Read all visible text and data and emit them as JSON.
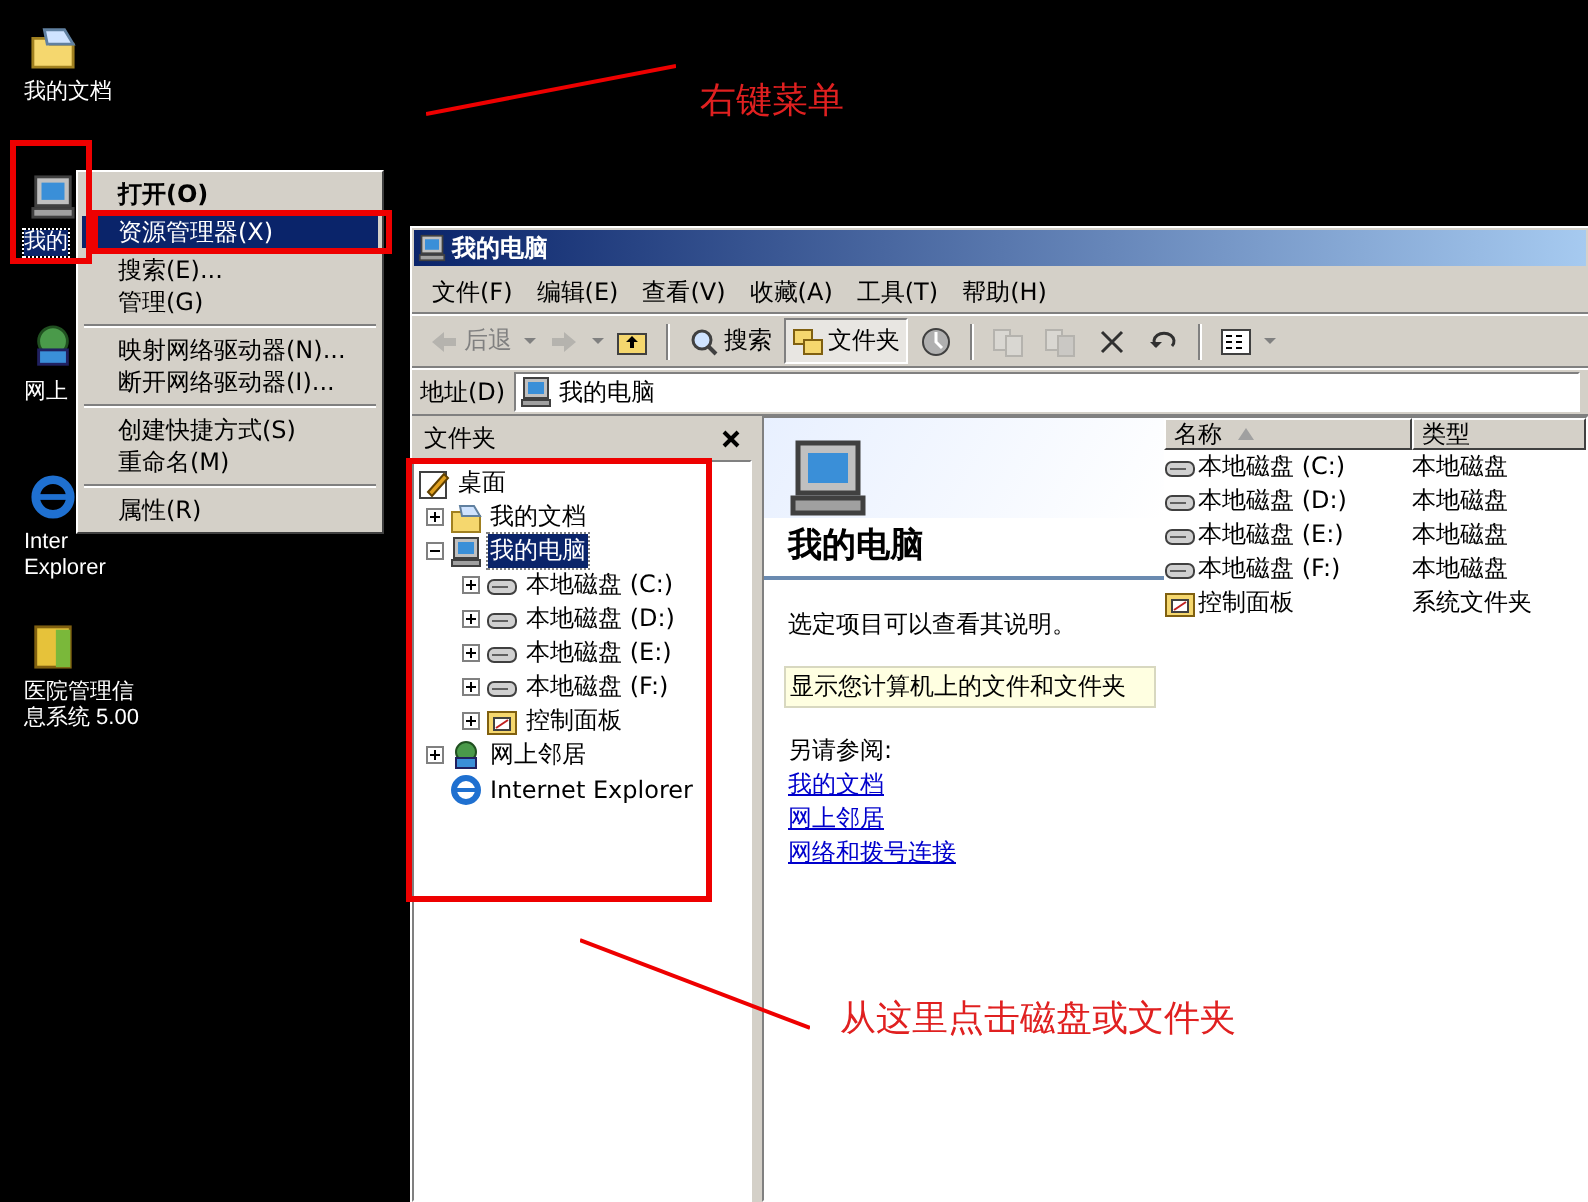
{
  "desktop_icons": [
    {
      "kind": "documents",
      "lines": [
        "我的文档"
      ],
      "selected": false
    },
    {
      "kind": "computer",
      "lines": [
        "我的"
      ],
      "selected": true
    },
    {
      "kind": "network",
      "lines": [
        "网上"
      ],
      "selected": false
    },
    {
      "kind": "ie",
      "lines": [
        "Inter",
        "Explorer"
      ],
      "selected": false
    },
    {
      "kind": "app",
      "lines": [
        "医院管理信",
        "息系统 5.00"
      ],
      "selected": false
    }
  ],
  "context_menu": [
    {
      "kind": "item",
      "label": "打开(O)",
      "default": true,
      "selected": false
    },
    {
      "kind": "item",
      "label": "资源管理器(X)",
      "default": false,
      "selected": true
    },
    {
      "kind": "item",
      "label": "搜索(E)...",
      "default": false,
      "selected": false
    },
    {
      "kind": "item",
      "label": "管理(G)",
      "default": false,
      "selected": false
    },
    {
      "kind": "separator"
    },
    {
      "kind": "item",
      "label": "映射网络驱动器(N)...",
      "default": false,
      "selected": false
    },
    {
      "kind": "item",
      "label": "断开网络驱动器(I)...",
      "default": false,
      "selected": false
    },
    {
      "kind": "separator"
    },
    {
      "kind": "item",
      "label": "创建快捷方式(S)",
      "default": false,
      "selected": false
    },
    {
      "kind": "item",
      "label": "重命名(M)",
      "default": false,
      "selected": false
    },
    {
      "kind": "separator"
    },
    {
      "kind": "item",
      "label": "属性(R)",
      "default": false,
      "selected": false
    }
  ],
  "window": {
    "title": "我的电脑",
    "menu": [
      "文件(F)",
      "编辑(E)",
      "查看(V)",
      "收藏(A)",
      "工具(T)",
      "帮助(H)"
    ],
    "toolbar": [
      {
        "kind": "back",
        "label": "后退",
        "disabled": true,
        "selected": false
      },
      {
        "kind": "forward",
        "disabled": true,
        "selected": false
      },
      {
        "kind": "up",
        "disabled": false,
        "selected": false
      },
      {
        "kind": "separator"
      },
      {
        "kind": "search",
        "label": "搜索",
        "disabled": false,
        "selected": false
      },
      {
        "kind": "folders",
        "label": "文件夹",
        "disabled": false,
        "selected": true
      },
      {
        "kind": "history",
        "disabled": false,
        "selected": false
      },
      {
        "kind": "separator"
      },
      {
        "kind": "move",
        "disabled": true,
        "selected": false
      },
      {
        "kind": "copy",
        "disabled": true,
        "selected": false
      },
      {
        "kind": "delete",
        "disabled": false,
        "selected": false
      },
      {
        "kind": "undo",
        "disabled": false,
        "selected": false
      },
      {
        "kind": "separator"
      },
      {
        "kind": "views",
        "disabled": false,
        "selected": false
      }
    ],
    "address": {
      "label": "地址(D)",
      "value": "我的电脑"
    },
    "folders_pane": {
      "title": "文件夹",
      "tree": [
        {
          "label": "桌面",
          "kind": "desktop",
          "selected": false,
          "children": [
            {
              "label": "我的文档",
              "kind": "documents",
              "expanded": false,
              "selected": false
            },
            {
              "label": "我的电脑",
              "kind": "computer",
              "expanded": true,
              "selected": true,
              "children": [
                {
                  "label": "本地磁盘 (C:)",
                  "kind": "drive",
                  "expanded": false,
                  "selected": false
                },
                {
                  "label": "本地磁盘 (D:)",
                  "kind": "drive",
                  "expanded": false,
                  "selected": false
                },
                {
                  "label": "本地磁盘 (E:)",
                  "kind": "drive",
                  "expanded": false,
                  "selected": false
                },
                {
                  "label": "本地磁盘 (F:)",
                  "kind": "drive",
                  "expanded": false,
                  "selected": false
                },
                {
                  "label": "控制面板",
                  "kind": "control",
                  "expanded": false,
                  "selected": false
                }
              ]
            },
            {
              "label": "网上邻居",
              "kind": "network",
              "expanded": false,
              "selected": false
            },
            {
              "label": "Internet Explorer",
              "kind": "ie",
              "selected": false
            }
          ]
        }
      ]
    },
    "info_panel": {
      "title": "我的电脑",
      "hint": "选定项目可以查看其说明。",
      "description": "显示您计算机上的文件和文件夹",
      "see_also": "另请参阅:",
      "links": [
        "我的文档",
        "网上邻居",
        "网络和拨号连接"
      ]
    },
    "list": {
      "columns": [
        {
          "label": "名称",
          "sorted": true
        },
        {
          "label": "类型",
          "sorted": false
        }
      ],
      "rows": [
        {
          "kind": "drive",
          "name": "本地磁盘 (C:)",
          "type": "本地磁盘"
        },
        {
          "kind": "drive",
          "name": "本地磁盘 (D:)",
          "type": "本地磁盘"
        },
        {
          "kind": "drive",
          "name": "本地磁盘 (E:)",
          "type": "本地磁盘"
        },
        {
          "kind": "drive",
          "name": "本地磁盘 (F:)",
          "type": "本地磁盘"
        },
        {
          "kind": "control",
          "name": "控制面板",
          "type": "系统文件夹"
        }
      ]
    }
  },
  "annotations": [
    "右键菜单",
    "从这里点击磁盘或文件夹"
  ]
}
